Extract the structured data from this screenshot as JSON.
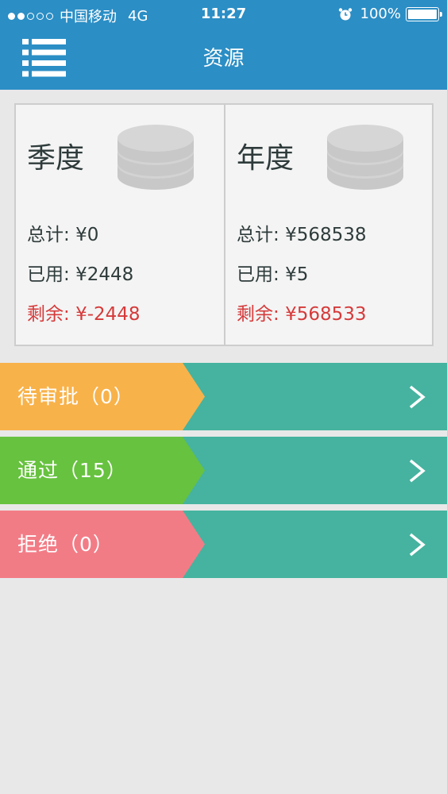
{
  "status_bar": {
    "carrier": "中国移动",
    "network": "4G",
    "time": "11:27",
    "battery": "100%",
    "signal_icon": "signal-dots",
    "alarm_icon": "alarm-clock",
    "battery_icon": "battery-full"
  },
  "nav": {
    "title": "资源",
    "menu_icon": "list-menu"
  },
  "cards": [
    {
      "title": "季度",
      "icon": "coin-stack",
      "total_label": "总计:",
      "total_value": "¥0",
      "used_label": "已用:",
      "used_value": "¥2448",
      "remaining_label": "剩余:",
      "remaining_value": "¥-2448"
    },
    {
      "title": "年度",
      "icon": "coin-stack",
      "total_label": "总计:",
      "total_value": "¥568538",
      "used_label": "已用:",
      "used_value": "¥5",
      "remaining_label": "剩余:",
      "remaining_value": "¥568533"
    }
  ],
  "status_rows": [
    {
      "label": "待审批（0）",
      "color": "#f8b24a"
    },
    {
      "label": "通过（15）",
      "color": "#67c23f"
    },
    {
      "label": "拒绝（0）",
      "color": "#f27c86"
    }
  ],
  "colors": {
    "header": "#2b8ec5",
    "row_background": "#45b39f",
    "remaining_text": "#d63a3a",
    "page_background": "#e8e8e9"
  }
}
